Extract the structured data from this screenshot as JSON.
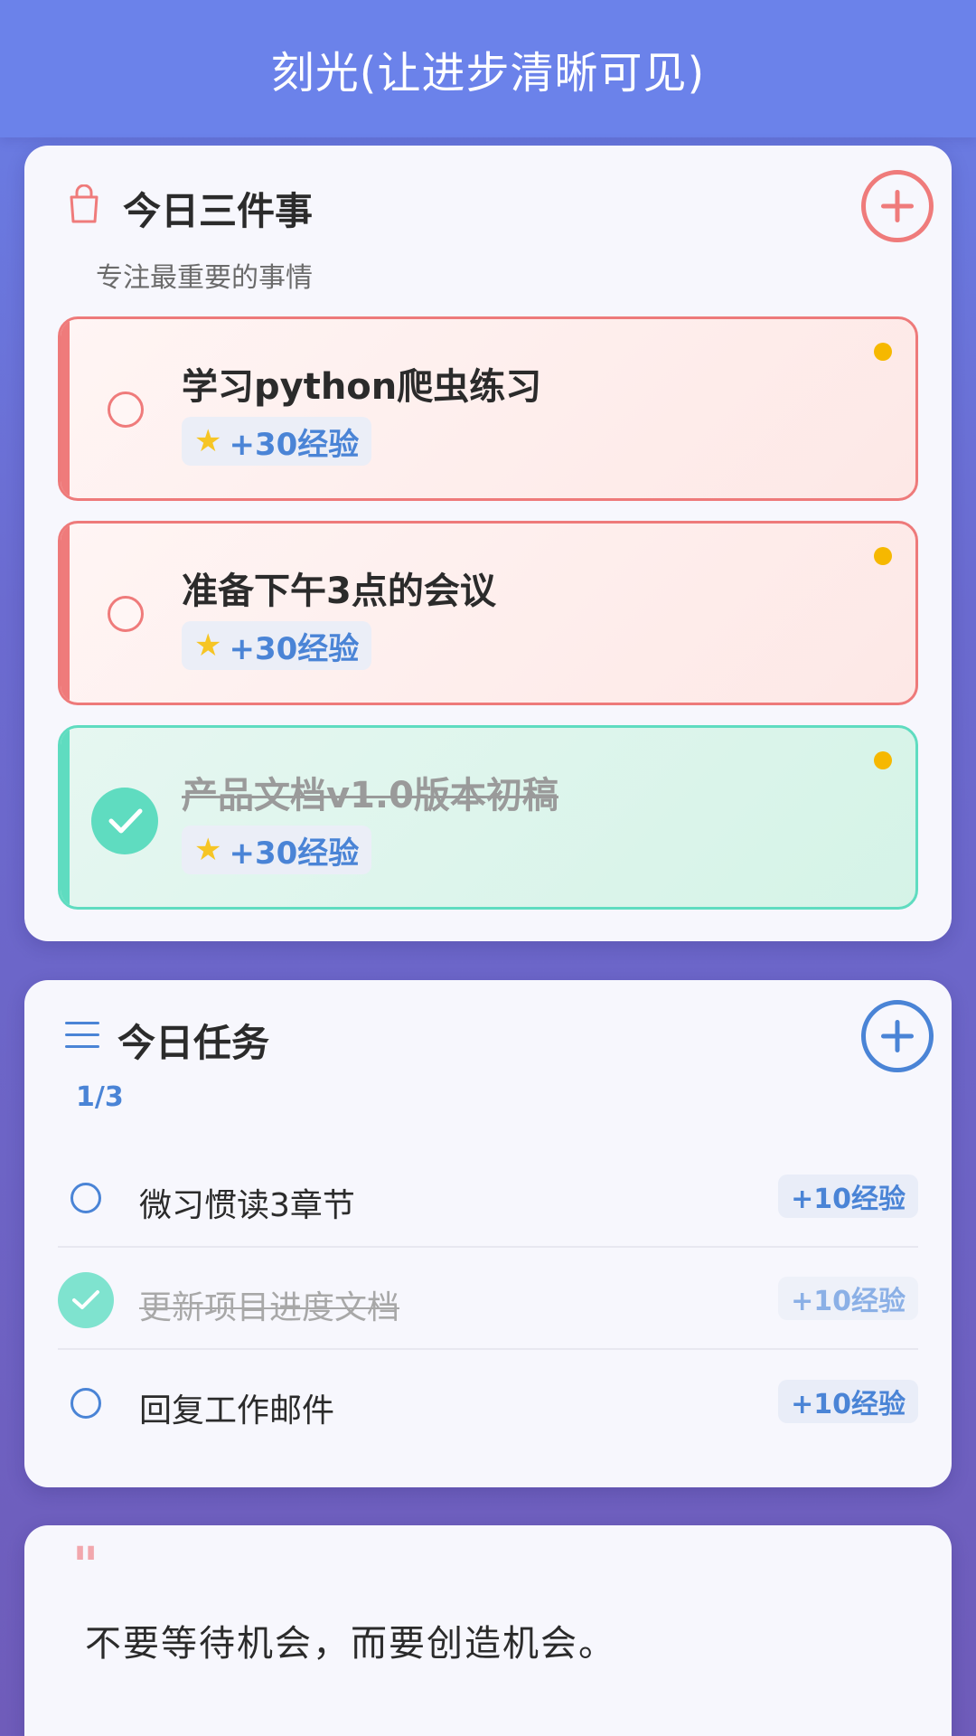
{
  "header": {
    "title": "刻光(让进步清晰可见)"
  },
  "focus": {
    "title": "今日三件事",
    "subtitle": "专注最重要的事情",
    "items": [
      {
        "label": "学习python爬虫练习",
        "xp": "+30经验",
        "done": false
      },
      {
        "label": "准备下午3点的会议",
        "xp": "+30经验",
        "done": false
      },
      {
        "label": "产品文档v1.0版本初稿",
        "xp": "+30经验",
        "done": true
      }
    ]
  },
  "tasks": {
    "title": "今日任务",
    "progress": "1/3",
    "items": [
      {
        "label": "微习惯读3章节",
        "xp": "+10经验",
        "done": false
      },
      {
        "label": "更新项目进度文档",
        "xp": "+10经验",
        "done": true
      },
      {
        "label": "回复工作邮件",
        "xp": "+10经验",
        "done": false
      }
    ]
  },
  "quote": {
    "mark": "\"",
    "text": "不要等待机会，而要创造机会。"
  },
  "icons": {
    "focus_header": "shopping-bag-icon",
    "tasks_header": "menu-icon",
    "add": "plus-circle-icon",
    "xp": "star-icon",
    "check": "checkmark-icon"
  },
  "colors": {
    "header_bg": "#6b82ea",
    "focus_accent": "#ef7b7b",
    "done_accent": "#5fdcc0",
    "task_accent": "#4a84d6",
    "priority_dot": "#f6b800"
  }
}
